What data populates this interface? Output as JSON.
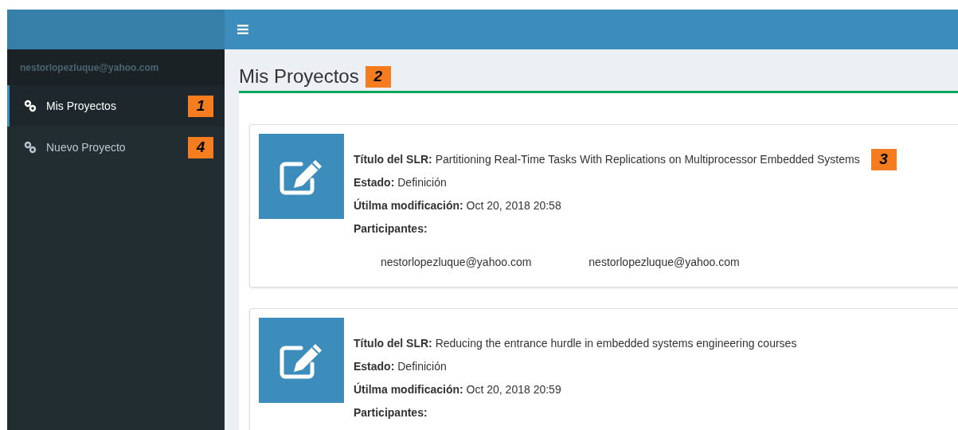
{
  "sidebar": {
    "user_email": "nestorlopezluque@yahoo.com",
    "items": [
      {
        "label": "Mis Proyectos",
        "selected": true,
        "callout": "1"
      },
      {
        "label": "Nuevo Proyecto",
        "selected": false,
        "callout": "4"
      }
    ]
  },
  "page": {
    "title": "Mis Proyectos",
    "callout": "2"
  },
  "projects": [
    {
      "fields": [
        {
          "label": "Título del SLR:",
          "value": "Partitioning Real-Time Tasks With Replications on Multiprocessor Embedded Systems"
        },
        {
          "label": "Estado:",
          "value": "Definición"
        },
        {
          "label": "Útilma modificación:",
          "value": "Oct 20, 2018 20:58"
        },
        {
          "label": "Participantes:"
        }
      ],
      "callout": "3",
      "participants": [
        "nestorlopezluque@yahoo.com",
        "nestorlopezluque@yahoo.com"
      ]
    },
    {
      "fields": [
        {
          "label": "Título del SLR:",
          "value": "Reducing the entrance hurdle in embedded systems engineering courses"
        },
        {
          "label": "Estado:",
          "value": "Definición"
        },
        {
          "label": "Útilma modificación:",
          "value": "Oct 20, 2018 20:59"
        },
        {
          "label": "Participantes:"
        }
      ]
    }
  ]
}
